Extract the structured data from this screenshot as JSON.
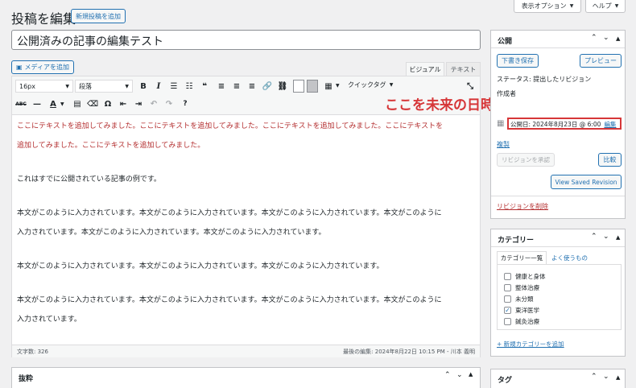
{
  "header": {
    "title": "投稿を編集",
    "add_new": "新規投稿を追加",
    "screen_options": "表示オプション",
    "help": "ヘルプ"
  },
  "post": {
    "title": "公開済みの記事の編集テスト"
  },
  "editor": {
    "add_media": "メディアを追加",
    "tab_visual": "ビジュアル",
    "tab_text": "テキスト",
    "font_size": "16px",
    "paragraph": "段落",
    "quick_tags": "クイックタグ",
    "red_line1": "ここにテキストを追加してみました。ここにテキストを追加してみました。ここにテキストを追加してみました。ここにテキストを",
    "red_line2": "追加してみました。ここにテキストを追加してみました。",
    "p1": "これはすでに公開されている記事の例です。",
    "p2_line1": "本文がこのように入力されています。本文がこのように入力されています。本文がこのように入力されています。本文がこのように",
    "p2_line2": "入力されています。本文がこのように入力されています。本文がこのように入力されています。",
    "p3": "本文がこのように入力されています。本文がこのように入力されています。本文がこのように入力されています。",
    "p4_line1": "本文がこのように入力されています。本文がこのように入力されています。本文がこのように入力されています。本文がこのように",
    "p4_line2": "入力されています。",
    "word_count": "文字数: 326",
    "last_edit": "最後の編集: 2024年8月22日 10:15 PM - 川本 義明"
  },
  "excerpt": {
    "title": "抜粋"
  },
  "annotation": "ここを未来の日時にして提出する",
  "publish": {
    "title": "公開",
    "save_draft": "下書き保存",
    "preview": "プレビュー",
    "status": "ステータス: 提出したリビジョン",
    "author_label": "作成者",
    "publish_date": "公開日: 2024年8月23日 @ 6:00",
    "edit": "編集",
    "copy": "複製",
    "approve": "リビジョンを承認",
    "compare": "比較",
    "view_saved": "View Saved Revision",
    "delete_revision": "リビジョンを削除"
  },
  "categories": {
    "title": "カテゴリー",
    "tab_all": "カテゴリー一覧",
    "tab_popular": "よく使うもの",
    "items": [
      {
        "label": "健康と身体",
        "checked": false
      },
      {
        "label": "整体治療",
        "checked": false
      },
      {
        "label": "未分類",
        "checked": false
      },
      {
        "label": "東洋医学",
        "checked": true
      },
      {
        "label": "鍼灸治療",
        "checked": false
      }
    ],
    "add_new": "+ 新規カテゴリーを追加"
  },
  "tags": {
    "title": "タグ"
  },
  "colors": {
    "accent": "#2271b1",
    "annotation": "#d63638",
    "red_text": "#b32d2e"
  }
}
